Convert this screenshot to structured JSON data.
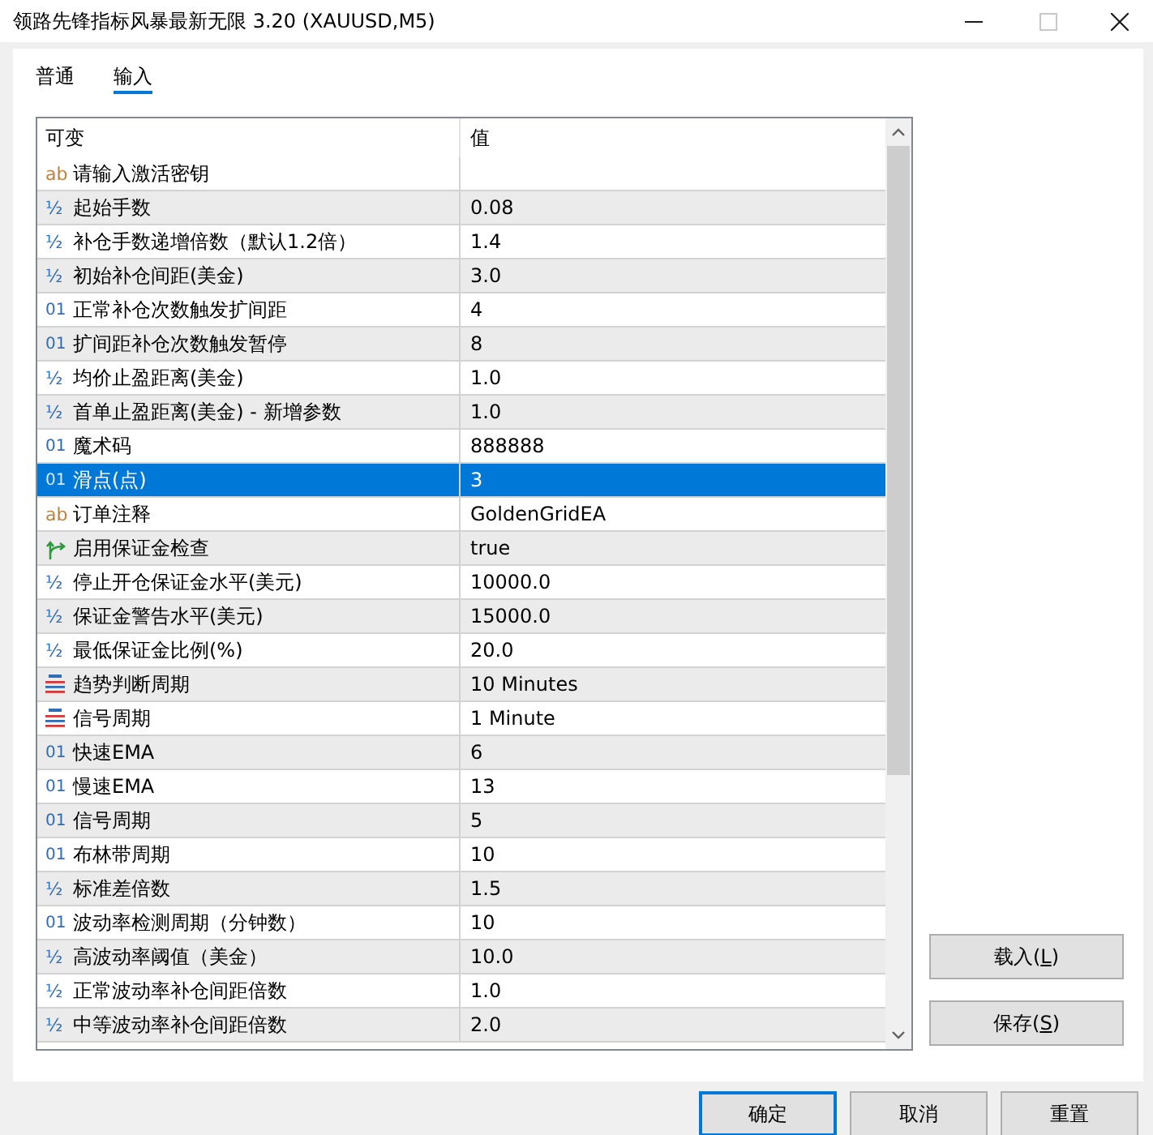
{
  "window": {
    "title": "领路先锋指标风暴最新无限 3.20 (XAUUSD,M5)",
    "controls": [
      {
        "kind": "minimize",
        "disabled": false
      },
      {
        "kind": "maximize",
        "disabled": true
      },
      {
        "kind": "close",
        "disabled": false
      }
    ]
  },
  "tabs": [
    {
      "label": "普通",
      "selected": false
    },
    {
      "label": "输入",
      "selected": true
    }
  ],
  "parameters": {
    "columns": [
      "可变",
      "值"
    ],
    "rows": [
      {
        "kind": "string",
        "icon": "ab",
        "name": "请输入激活密钥",
        "selected": false
      },
      {
        "kind": "double",
        "icon": "½",
        "name": "起始手数",
        "value": "0.08",
        "selected": false
      },
      {
        "kind": "double",
        "icon": "½",
        "name": "补仓手数递增倍数（默认1.2倍）",
        "value": "1.4",
        "selected": false
      },
      {
        "kind": "double",
        "icon": "½",
        "name": "初始补仓间距(美金)",
        "value": "3.0",
        "selected": false
      },
      {
        "kind": "integer",
        "icon": "01",
        "name": "正常补仓次数触发扩间距",
        "value": "4",
        "selected": false
      },
      {
        "kind": "integer",
        "icon": "01",
        "name": "扩间距补仓次数触发暂停",
        "value": "8",
        "selected": false
      },
      {
        "kind": "double",
        "icon": "½",
        "name": "均价止盈距离(美金)",
        "value": "1.0",
        "selected": false
      },
      {
        "kind": "double",
        "icon": "½",
        "name": "首单止盈距离(美金) - 新增参数",
        "value": "1.0",
        "selected": false
      },
      {
        "kind": "integer",
        "icon": "01",
        "name": "魔术码",
        "value": "888888",
        "selected": false
      },
      {
        "kind": "integer",
        "icon": "01",
        "name": "滑点(点)",
        "value": "3",
        "selected": true
      },
      {
        "kind": "string",
        "icon": "ab",
        "name": "订单注释",
        "value": "GoldenGridEA",
        "selected": false
      },
      {
        "kind": "bool",
        "name": "启用保证金检查",
        "value": "true",
        "selected": false
      },
      {
        "kind": "double",
        "icon": "½",
        "name": "停止开仓保证金水平(美元)",
        "value": "10000.0",
        "selected": false
      },
      {
        "kind": "double",
        "icon": "½",
        "name": "保证金警告水平(美元)",
        "value": "15000.0",
        "selected": false
      },
      {
        "kind": "double",
        "icon": "½",
        "name": "最低保证金比例(%)",
        "value": "20.0",
        "selected": false
      },
      {
        "kind": "enum",
        "name": "趋势判断周期",
        "value": "10 Minutes",
        "selected": false
      },
      {
        "kind": "enum",
        "name": "信号周期",
        "value": "1 Minute",
        "selected": false
      },
      {
        "kind": "integer",
        "icon": "01",
        "name": "快速EMA",
        "value": "6",
        "selected": false
      },
      {
        "kind": "integer",
        "icon": "01",
        "name": "慢速EMA",
        "value": "13",
        "selected": false
      },
      {
        "kind": "integer",
        "icon": "01",
        "name": "信号周期",
        "value": "5",
        "selected": false
      },
      {
        "kind": "integer",
        "icon": "01",
        "name": "布林带周期",
        "value": "10",
        "selected": false
      },
      {
        "kind": "double",
        "icon": "½",
        "name": "标准差倍数",
        "value": "1.5",
        "selected": false
      },
      {
        "kind": "integer",
        "icon": "01",
        "name": "波动率检测周期（分钟数）",
        "value": "10",
        "selected": false
      },
      {
        "kind": "double",
        "icon": "½",
        "name": "高波动率阈值（美金）",
        "value": "10.0",
        "selected": false
      },
      {
        "kind": "double",
        "icon": "½",
        "name": "正常波动率补仓间距倍数",
        "value": "1.0",
        "selected": false
      },
      {
        "kind": "double",
        "icon": "½",
        "name": "中等波动率补仓间距倍数",
        "value": "2.0",
        "selected": false
      }
    ]
  },
  "side_buttons": [
    {
      "label": "载入(",
      "access_key": "L",
      "label_end": ")"
    },
    {
      "label": "保存(",
      "access_key": "S",
      "label_end": ")"
    }
  ],
  "buttons": [
    {
      "label": "确定",
      "default": true
    },
    {
      "label": "取消",
      "default": false
    },
    {
      "label": "重置",
      "default": false
    }
  ]
}
